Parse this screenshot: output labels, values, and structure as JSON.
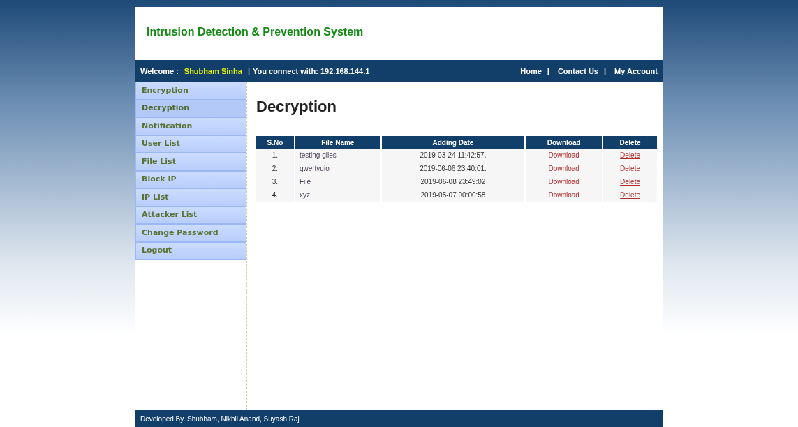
{
  "header": {
    "title": "Intrusion Detection & Prevention System"
  },
  "topbar": {
    "welcome_label": "Welcome :",
    "user": "Shubham Sinha",
    "separator": "|",
    "connection": "You connect with: 192.168.144.1",
    "links": [
      {
        "label": "Home",
        "separator": "|"
      },
      {
        "label": "Contact Us",
        "separator": "|"
      },
      {
        "label": "My Account"
      }
    ]
  },
  "sidebar": {
    "items": [
      {
        "label": "Encryption",
        "selected": false
      },
      {
        "label": "Decryption",
        "selected": true
      },
      {
        "label": "Notification",
        "selected": false
      },
      {
        "label": "User List",
        "selected": false
      },
      {
        "label": "File List",
        "selected": false
      },
      {
        "label": "Block IP",
        "selected": false
      },
      {
        "label": "IP List",
        "selected": false
      },
      {
        "label": "Attacker List",
        "selected": false
      },
      {
        "label": "Change Password",
        "selected": false
      },
      {
        "label": "Logout",
        "selected": false
      }
    ]
  },
  "page": {
    "heading": "Decryption"
  },
  "table": {
    "columns": [
      "S.No",
      "File Name",
      "Adding Date",
      "Download",
      "Delete"
    ],
    "rows": [
      {
        "sno": "1.",
        "file_name": "testing giles",
        "date": "2019-03-24 11:42:57.",
        "download": "Download",
        "delete": "Delete"
      },
      {
        "sno": "2.",
        "file_name": "qwertyuio",
        "date": "2019-06-06 23:40:01.",
        "download": "Download",
        "delete": "Delete"
      },
      {
        "sno": "3.",
        "file_name": "File",
        "date": "2019-06-08 23:49:02",
        "download": "Download",
        "delete": "Delete"
      },
      {
        "sno": "4.",
        "file_name": "xyz",
        "date": "2019-05-07 00:00:58",
        "download": "Download",
        "delete": "Delete"
      }
    ]
  },
  "footer": {
    "text": "Developed By. Shubham, Nikhil Anand, Suyash Raj"
  }
}
